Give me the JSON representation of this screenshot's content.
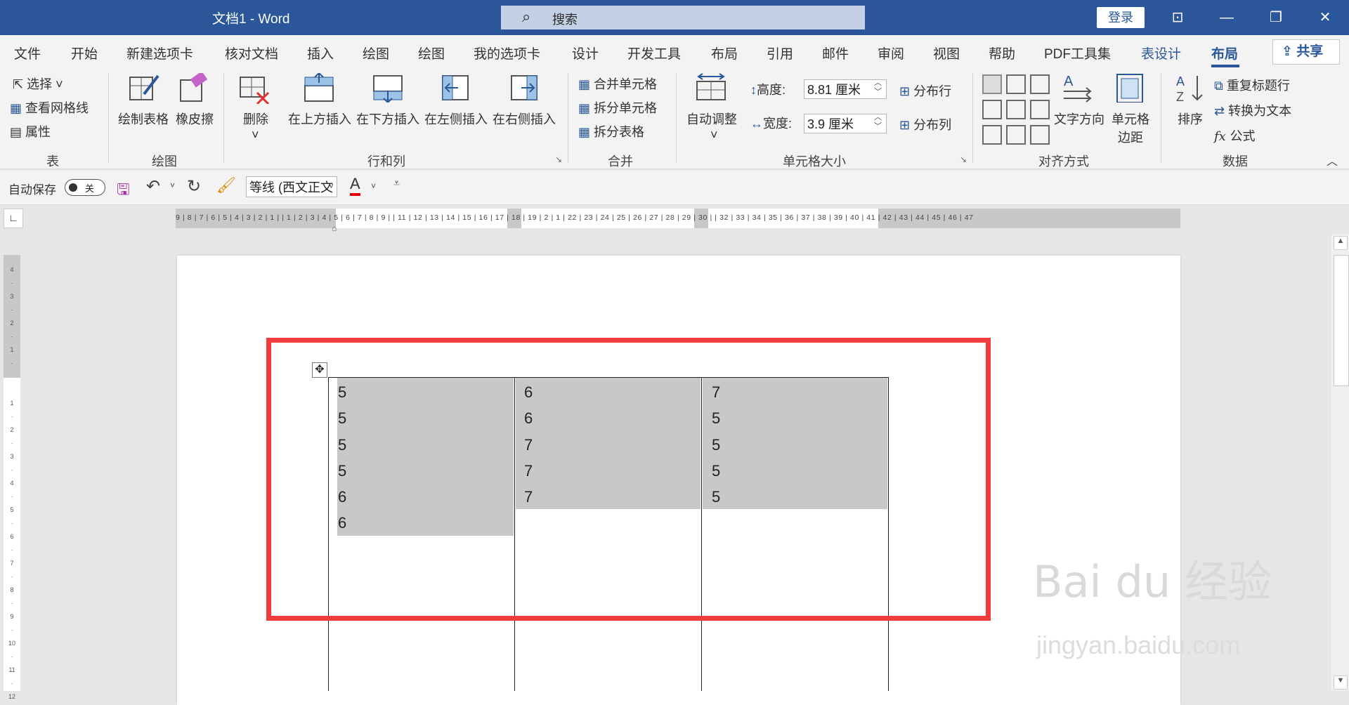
{
  "titlebar": {
    "title": "文档1  -  Word",
    "search": "搜索",
    "login": "登录",
    "buttons": [
      "ribbon-display",
      "minimize",
      "restore",
      "close"
    ]
  },
  "tabs": [
    "文件",
    "开始",
    "新建选项卡",
    "核对文档",
    "插入",
    "绘图",
    "绘图",
    "我的选项卡",
    "设计",
    "开发工具",
    "布局",
    "引用",
    "邮件",
    "审阅",
    "视图",
    "帮助",
    "PDF工具集",
    "表设计",
    "布局"
  ],
  "share": "共享",
  "ribbon": {
    "table_group": {
      "label": "表",
      "select": "选择",
      "gridlines": "查看网格线",
      "properties": "属性"
    },
    "draw_group": {
      "label": "绘图",
      "draw_table": "绘制表格",
      "eraser": "橡皮擦"
    },
    "rows_cols_group": {
      "label": "行和列",
      "delete": "删除",
      "insert_above": "在上方插入",
      "insert_below": "在下方插入",
      "insert_left": "在左侧插入",
      "insert_right": "在右侧插入"
    },
    "merge_group": {
      "label": "合并",
      "merge_cells": "合并单元格",
      "split_cells": "拆分单元格",
      "split_table": "拆分表格"
    },
    "size_group": {
      "label": "单元格大小",
      "autofit": "自动调整",
      "height_label": "高度:",
      "height_value": "8.81 厘米",
      "width_label": "宽度:",
      "width_value": "3.9 厘米",
      "distribute_rows": "分布行",
      "distribute_cols": "分布列"
    },
    "align_group": {
      "label": "对齐方式",
      "text_direction": "文字方向",
      "cell_margins_1": "单元格",
      "cell_margins_2": "边距"
    },
    "data_group": {
      "label": "数据",
      "sort": "排序",
      "repeat_header": "重复标题行",
      "convert_text": "转换为文本",
      "formula": "公式"
    }
  },
  "qat": {
    "autosave": "自动保存",
    "toggle": "关",
    "font": "等线 (西文正文"
  },
  "ruler_h": "9 | 8 | 7 | 6 | 5 | 4 | 3 | 2 | 1 |      | 1 | 2 | 3 | 4 | 5 | 6 | 7 | 8 | 9 |      | 11 | 12 | 13 | 14 | 15 | 16 | 17 | 18 | 19 | 2    | 1 | 22 | 23 | 24 | 25 | 26 | 27 | 28 | 29 | 30 |      | 32 | 33 | 34 | 35 | 36 | 37 | 38 | 39 | 40 | 41 | 42 | 43 | 44 | 45 | 46 | 47",
  "table": {
    "col1": [
      "5",
      "5",
      "5",
      "5",
      "6",
      "6"
    ],
    "col2": [
      "6",
      "6",
      "7",
      "7",
      "7"
    ],
    "col3": [
      "7",
      "5",
      "5",
      "5",
      "5"
    ]
  },
  "watermark": {
    "brand": "Bai du 经验",
    "url": "jingyan.baidu.com"
  },
  "colors": {
    "accent": "#2b579a",
    "highlight": "#f03c3c",
    "selection": "#c8c8c8"
  }
}
